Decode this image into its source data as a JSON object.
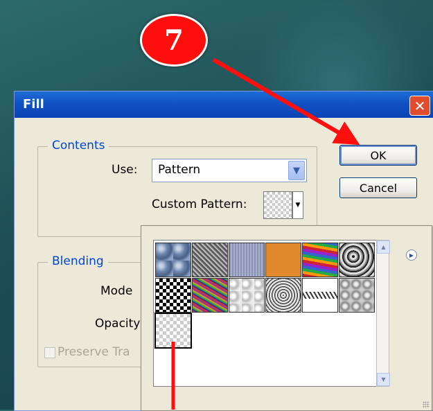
{
  "step_badge": "7",
  "dialog": {
    "title": "Fill",
    "close_glyph": "✕",
    "ok_label": "OK",
    "cancel_label": "Cancel"
  },
  "contents": {
    "group_label": "Contents",
    "use_label": "Use:",
    "use_value": "Pattern",
    "custom_pattern_label": "Custom Pattern:"
  },
  "blending": {
    "group_label": "Blending",
    "mode_label": "Mode",
    "opacity_label": "Opacity",
    "preserve_label": "Preserve Tra"
  },
  "pattern_picker": {
    "patterns": [
      {
        "name": "bubbles"
      },
      {
        "name": "wrinkles"
      },
      {
        "name": "fine-lines"
      },
      {
        "name": "orange-solid"
      },
      {
        "name": "tie-dye"
      },
      {
        "name": "marble-mottle"
      },
      {
        "name": "checkerboard"
      },
      {
        "name": "multicolor-noise"
      },
      {
        "name": "clouds"
      },
      {
        "name": "gravel"
      },
      {
        "name": "rope"
      },
      {
        "name": "stone-gray"
      },
      {
        "name": "transparent-checker"
      }
    ],
    "selected": "transparent-checker"
  },
  "colors": {
    "annotation": "#ff0e0e",
    "title_bar": "#0f4fc2",
    "dialog_bg": "#ece9d8",
    "group_label": "#0046d5"
  }
}
